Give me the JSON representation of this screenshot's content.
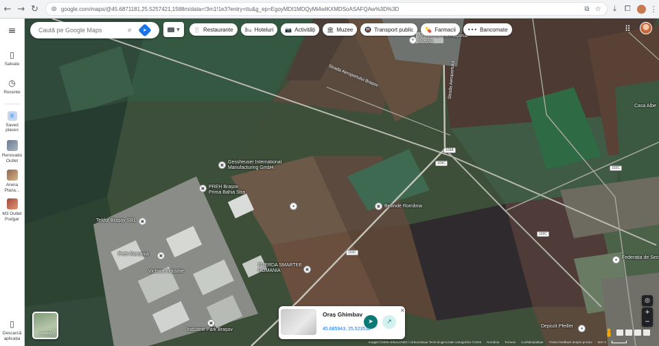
{
  "browser": {
    "url": "google.com/maps/@45.6871181,25.5257421,1588m/data=!3m1!1e3?entry=ttu&g_ep=EgoyMDI1MDQyMi4wIKXMDSoASAFQAw%3D%3D",
    "back_icon": "←",
    "forward_icon": "→",
    "reload_icon": "↻"
  },
  "sidebar": {
    "menu_icon": "≡",
    "items": [
      {
        "label": "Salvate",
        "icon": "bookmark-icon"
      },
      {
        "label": "Recente",
        "icon": "history-icon"
      },
      {
        "label": "Saved places",
        "icon": "saved-places-icon"
      },
      {
        "label": "Renovatio Outlet",
        "icon": "place-thumb"
      },
      {
        "label": "Arena Plaza...",
        "icon": "place-thumb"
      },
      {
        "label": "M3 Outlet Podgar",
        "icon": "place-thumb"
      }
    ],
    "bottom_label": "Descarcă aplicația"
  },
  "search": {
    "placeholder": "Caută pe Google Maps"
  },
  "chips": [
    {
      "label": "Restaurante",
      "icon": "🍴"
    },
    {
      "label": "Hoteluri",
      "icon": "🛏"
    },
    {
      "label": "Activități",
      "icon": "📷"
    },
    {
      "label": "Muzee",
      "icon": "🏛"
    },
    {
      "label": "Transport public",
      "icon": "🚇"
    },
    {
      "label": "Farmacii",
      "icon": "💊"
    },
    {
      "label": "Bancomate",
      "icon": "•••"
    }
  ],
  "map_labels": {
    "airport": "Aeroportul Internațional\nBrașov",
    "casa_alba": "Casa Albe",
    "geiss": "Gessheuser International\nManufacturing GmbH",
    "preh": "PREH Brașov\nPrima Bahia Stra",
    "telefor": "Tekfor Brașov SRL",
    "phm": "Preh Romania",
    "roplast": "Victoria Industrie",
    "fuerda": "FUERDA SMARTEE\nROMANIA",
    "parc": "Industrie Park Brașov",
    "benke": "Bellinde România",
    "teleglat": "Federația de Sectii de Zaha",
    "depozit": "Depozit Pfeiller",
    "road_aeroport": "Strada Aeroportului Brașov",
    "road_aer_right": "Strada Aeroportului",
    "shield_1": "103A",
    "shield_2": "103C",
    "shield_3": "103C",
    "shield_4": "103C",
    "shield_5": "102C",
    "shield_6": "103C"
  },
  "place_card": {
    "title": "Oraș Ghimbav",
    "coords": "45.685943, 25.523532",
    "close_icon": "✕",
    "directions_icon": "➤",
    "share_icon": "↗"
  },
  "layer_toggle": {
    "label": "Straturi"
  },
  "footer": {
    "attribution": "Imagini ©2025 Airbus,CNES / Airbus,Maxar Technologies,Date cartografice ©2025",
    "links": [
      "România",
      "Termeni",
      "Confidențialitate",
      "Trimite feedback despre produs"
    ],
    "scale": "500 m"
  }
}
